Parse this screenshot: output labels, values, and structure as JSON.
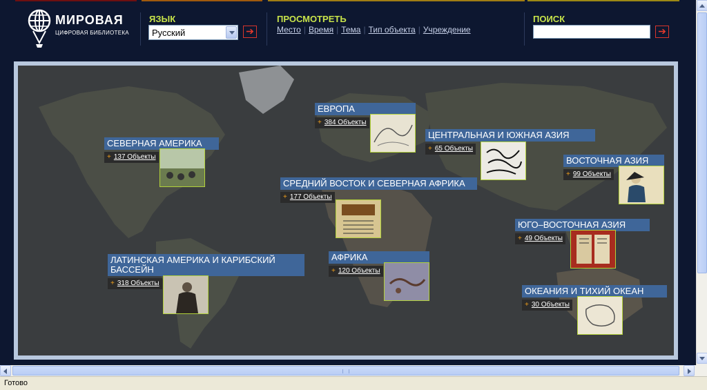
{
  "header": {
    "logo_title": "МИРОВАЯ",
    "logo_subtitle": "ЦИФРОВАЯ БИБЛИОТЕКА",
    "language": {
      "title": "ЯЗЫК",
      "selected": "Русский",
      "go_label": "➔"
    },
    "browse": {
      "title": "ПРОСМОТРЕТЬ",
      "links": [
        "Место",
        "Время",
        "Тема",
        "Тип объекта",
        "Учреждение"
      ]
    },
    "search": {
      "title": "ПОИСК",
      "value": "",
      "go_label": "➔"
    }
  },
  "map": {
    "regions": [
      {
        "title": "СЕВЕРНАЯ АМЕРИКА",
        "count": "137 Объекты",
        "thumb": "photo"
      },
      {
        "title": "ЕВРОПА",
        "count": "384 Объекты",
        "thumb": "map"
      },
      {
        "title": "ЦЕНТРАЛЬНАЯ И ЮЖНАЯ АЗИЯ",
        "count": "65 Объекты",
        "thumb": "calligraphy"
      },
      {
        "title": "ВОСТОЧНАЯ АЗИЯ",
        "count": "99 Объекты",
        "thumb": "painting"
      },
      {
        "title": "СРЕДНИЙ ВОСТОК И СЕВЕРНАЯ АФРИКА",
        "count": "177 Объекты",
        "thumb": "manuscript"
      },
      {
        "title": "ЮГО–ВОСТОЧНАЯ АЗИЯ",
        "count": "49 Объекты",
        "thumb": "book"
      },
      {
        "title": "ЛАТИНСКАЯ АМЕРИКА И КАРИБСКИЙ БАССЕЙН",
        "count": "318 Объекты",
        "thumb": "portrait"
      },
      {
        "title": "АФРИКА",
        "count": "120 Объекты",
        "thumb": "rock-art"
      },
      {
        "title": "ОКЕАНИЯ И ТИХИЙ ОКЕАН",
        "count": "30 Объекты",
        "thumb": "map"
      }
    ]
  },
  "status_bar": {
    "text": "Готово"
  }
}
